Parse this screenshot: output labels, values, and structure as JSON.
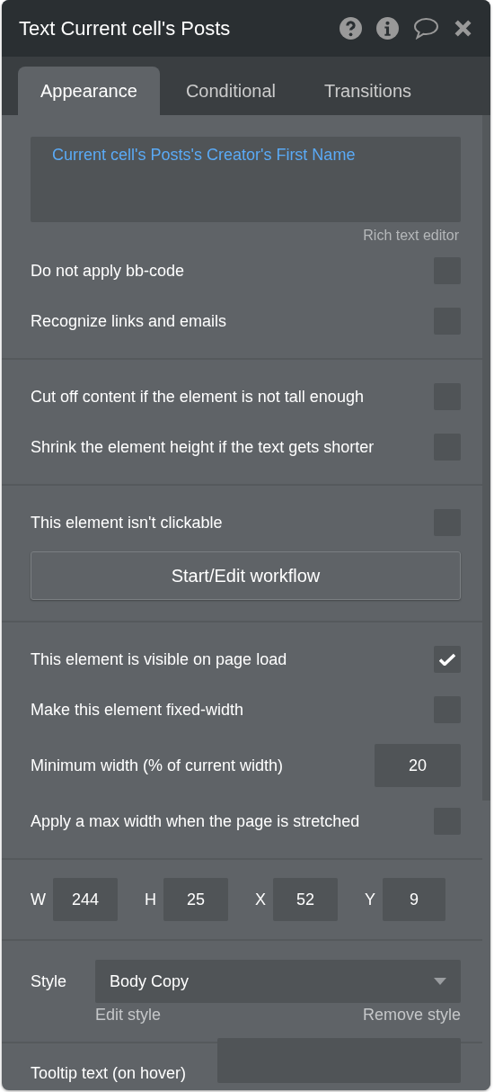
{
  "title": "Text Current cell's Posts",
  "tabs": [
    {
      "label": "Appearance",
      "selected": true
    },
    {
      "label": "Conditional",
      "selected": false
    },
    {
      "label": "Transitions",
      "selected": false
    }
  ],
  "content": {
    "value": "Current cell's Posts's Creator's First Name",
    "hint": "Rich text editor"
  },
  "sections": [
    {
      "rows": [
        {
          "kind": "checkbox",
          "label": "Do not apply bb-code",
          "checked": false
        },
        {
          "kind": "checkbox",
          "label": "Recognize links and emails",
          "checked": false
        }
      ]
    },
    {
      "rows": [
        {
          "kind": "checkbox",
          "label": "Cut off content if the element is not tall enough",
          "checked": false
        },
        {
          "kind": "checkbox",
          "label": "Shrink the element height if the text gets shorter",
          "checked": false
        }
      ]
    },
    {
      "rows": [
        {
          "kind": "checkbox",
          "label": "This element isn't clickable",
          "checked": false
        },
        {
          "kind": "button",
          "label": "Start/Edit workflow"
        }
      ]
    },
    {
      "rows": [
        {
          "kind": "checkbox",
          "label": "This element is visible on page load",
          "checked": true
        },
        {
          "kind": "checkbox",
          "label": "Make this element fixed-width",
          "checked": false
        },
        {
          "kind": "number",
          "label": "Minimum width (% of current width)",
          "value": "20"
        },
        {
          "kind": "checkbox",
          "label": "Apply a max width when the page is stretched",
          "checked": false
        }
      ]
    },
    {
      "rows": [
        {
          "kind": "dims",
          "fields": [
            {
              "label": "W",
              "value": "244"
            },
            {
              "label": "H",
              "value": "25"
            },
            {
              "label": "X",
              "value": "52"
            },
            {
              "label": "Y",
              "value": "9"
            }
          ]
        }
      ]
    },
    {
      "rows": [
        {
          "kind": "style",
          "label": "Style",
          "value": "Body Copy",
          "links": [
            "Edit style",
            "Remove style"
          ]
        }
      ]
    },
    {
      "rows": [
        {
          "kind": "text",
          "label": "Tooltip text (on hover)"
        }
      ]
    }
  ]
}
